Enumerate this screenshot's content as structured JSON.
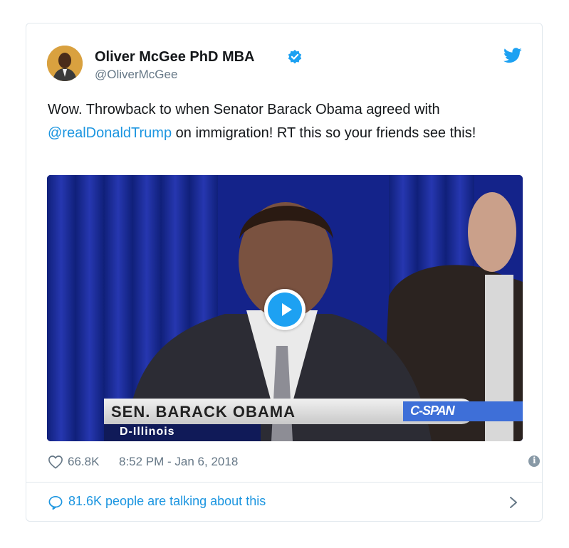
{
  "tweet": {
    "author": {
      "display_name": "Oliver McGee PhD MBA",
      "handle": "@OliverMcGee",
      "verified": true,
      "avatar_icon": "user-avatar"
    },
    "text_part1": "Wow. Throwback to when Senator Barack Obama agreed with ",
    "mention": "@realDonaldTrump",
    "text_part2": " on immigration! RT this so your friends see this!",
    "media": {
      "type": "video",
      "chyron_name": "SEN. BARACK OBAMA",
      "chyron_subtitle": "D-Illinois",
      "network_logo": "C-SPAN"
    },
    "likes": "66.8K",
    "timestamp": "8:52 PM - Jan 6, 2018",
    "conversation": "81.6K people are talking about this"
  },
  "colors": {
    "twitter_blue": "#1da1f2",
    "link_blue": "#1b95e0",
    "muted_text": "#657786",
    "border": "#e1e8ed"
  },
  "icons": [
    "twitter-bird-icon",
    "verified-badge-icon",
    "play-icon",
    "heart-icon",
    "info-icon",
    "speech-bubble-icon",
    "chevron-right-icon"
  ]
}
